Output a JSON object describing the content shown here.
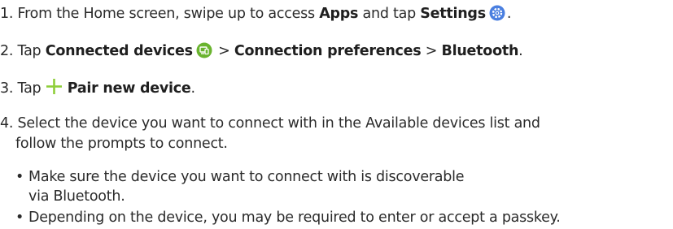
{
  "steps": [
    {
      "number": "1.",
      "part1": "From the Home screen, swipe up to access ",
      "bold1": "Apps",
      "part2": " and tap ",
      "bold2": "Settings",
      "icon": "settings-gear-icon",
      "end": "."
    },
    {
      "number": "2.",
      "part1": "Tap ",
      "bold1": "Connected devices",
      "icon": "connected-devices-icon",
      "sep1": " > ",
      "bold2": "Connection preferences",
      "sep2": " > ",
      "bold3": "Bluetooth",
      "end": "."
    },
    {
      "number": "3.",
      "part1": "Tap ",
      "icon": "plus-icon",
      "bold1": "Pair new device",
      "end": "."
    },
    {
      "number": "4.",
      "line1": "Select the device you want to connect with in the Available devices list and",
      "line2": "follow the prompts to connect.",
      "bullets": [
        {
          "line1": "Make sure the device you want to connect with is discoverable",
          "line2": "via Bluetooth."
        },
        {
          "line1": "Depending on the device, you may be required to enter or accept a passkey."
        }
      ]
    }
  ],
  "colors": {
    "text": "#2b2b2b",
    "settings_icon": "#4a7fe0",
    "devices_icon": "#6ab42f",
    "plus_icon": "#8fce3a"
  }
}
